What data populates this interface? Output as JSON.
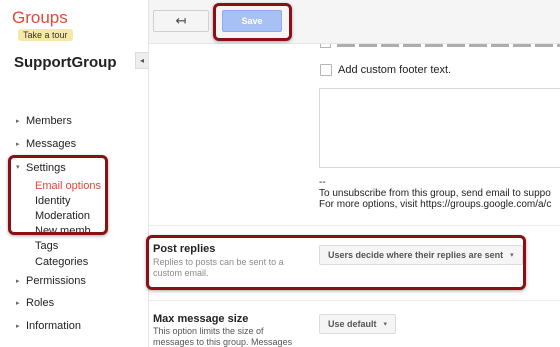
{
  "app": {
    "brand": "Groups",
    "tour_label": "Take a tour"
  },
  "group": {
    "name": "SupportGroup"
  },
  "toolbar": {
    "back_icon": "↤",
    "save_label": "Save"
  },
  "sidebar": {
    "collapse_icon": "◂",
    "items": [
      {
        "label": "Members",
        "expanded": false
      },
      {
        "label": "Messages",
        "expanded": false
      },
      {
        "label": "Settings",
        "expanded": true
      },
      {
        "label": "Permissions",
        "expanded": false
      },
      {
        "label": "Roles",
        "expanded": false
      },
      {
        "label": "Information",
        "expanded": false
      }
    ],
    "settings_sub": [
      {
        "label": "Email options",
        "active": true
      },
      {
        "label": "Identity",
        "active": false
      },
      {
        "label": "Moderation",
        "active": false
      },
      {
        "label": "New memb",
        "active": false
      },
      {
        "label": "Tags",
        "active": false
      },
      {
        "label": "Categories",
        "active": false
      }
    ],
    "arrow_collapsed": "▸",
    "arrow_expanded": "▾"
  },
  "main": {
    "custom_footer_label": "Add custom footer text.",
    "footer_preview": {
      "dashes": "--",
      "line1": "To unsubscribe from this group, send email to suppo",
      "line2": "For more options, visit https://groups.google.com/a/c"
    },
    "post_replies": {
      "title": "Post replies",
      "desc": "Replies to posts can be sent to a custom email.",
      "value": "Users decide where their replies are sent"
    },
    "max_message_size": {
      "title": "Max message size",
      "desc": "This option limits the size of messages to this group. Messages",
      "value": "Use default"
    },
    "caret": "▾"
  },
  "colors": {
    "brand": "#dd4b39",
    "annotation": "#8b0f14",
    "save": "#a9c0f5"
  }
}
